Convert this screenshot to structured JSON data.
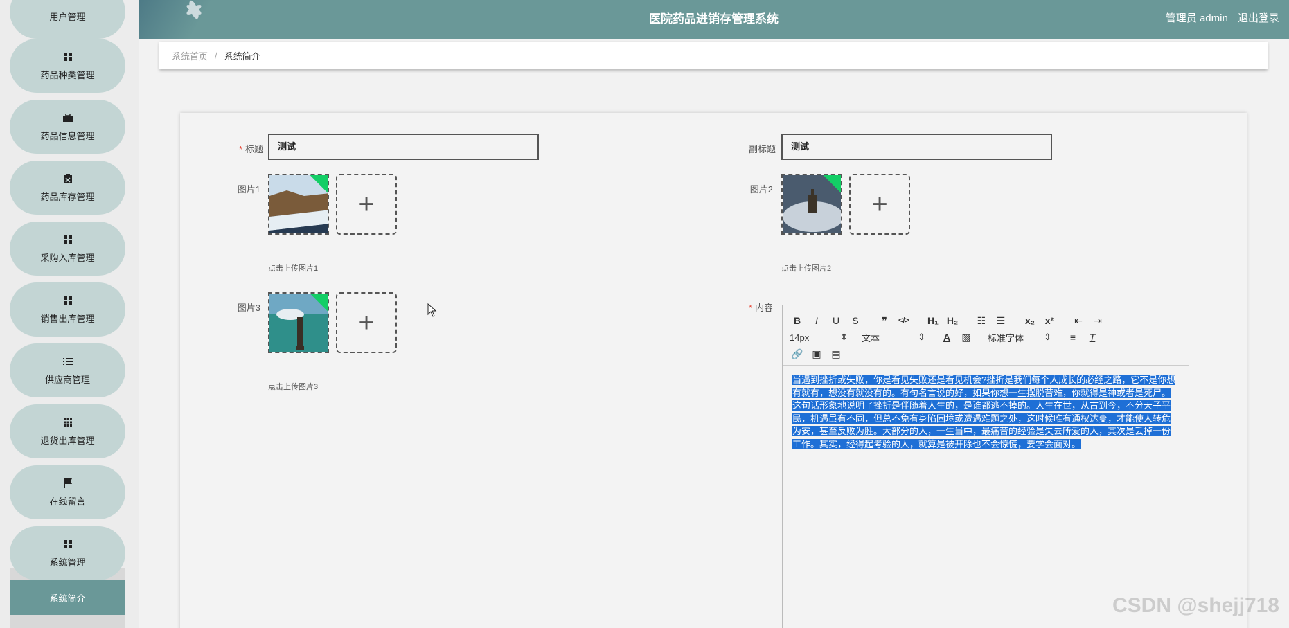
{
  "header": {
    "title": "医院药品进销存管理系统",
    "user_label": "管理员 admin",
    "logout": "退出登录"
  },
  "sidebar": {
    "items": [
      {
        "label": "用户管理",
        "icon": "grid-icon"
      },
      {
        "label": "药品种类管理",
        "icon": "grid-icon"
      },
      {
        "label": "药品信息管理",
        "icon": "briefcase-icon"
      },
      {
        "label": "药品库存管理",
        "icon": "clipboard-icon"
      },
      {
        "label": "采购入库管理",
        "icon": "grid-icon"
      },
      {
        "label": "销售出库管理",
        "icon": "grid-icon"
      },
      {
        "label": "供应商管理",
        "icon": "list-icon"
      },
      {
        "label": "退货出库管理",
        "icon": "apps-icon"
      },
      {
        "label": "在线留言",
        "icon": "flag-icon"
      },
      {
        "label": "系统管理",
        "icon": "grid-icon"
      }
    ],
    "sub_active": "系统简介"
  },
  "breadcrumb": {
    "home": "系统首页",
    "sep": "/",
    "current": "系统简介"
  },
  "form": {
    "title_label": "标题",
    "title_value": "测试",
    "subtitle_label": "副标题",
    "subtitle_value": "测试",
    "img1_label": "图片1",
    "img1_tip": "点击上传图片1",
    "img2_label": "图片2",
    "img2_tip": "点击上传图片2",
    "img3_label": "图片3",
    "img3_tip": "点击上传图片3",
    "content_label": "内容",
    "required_mark": "*"
  },
  "editor": {
    "font_size": "14px",
    "block_type": "文本",
    "font_family": "标准字体",
    "content": "当遇到挫折或失败，你是看见失败还是看见机会?挫折是我们每个人成长的必经之路，它不是你想有就有，想没有就没有的。有句名言说的好，如果你想一生摆脱苦难，你就得是神或者是死尸。这句话形象地说明了挫折是伴随着人生的，是谁都逃不掉的。人生在世，从古到今，不分天子平民，机遇虽有不同，但总不免有身陷困境或遭遇难题之处，这时候唯有通权达变，才能使人转危为安，甚至反败为胜。大部分的人，一生当中，最痛苦的经验是失去所爱的人，其次是丢掉一份工作。其实，经得起考验的人，就算是被开除也不会惊慌，要学会面对。"
  },
  "watermark": "CSDN @shejj718"
}
